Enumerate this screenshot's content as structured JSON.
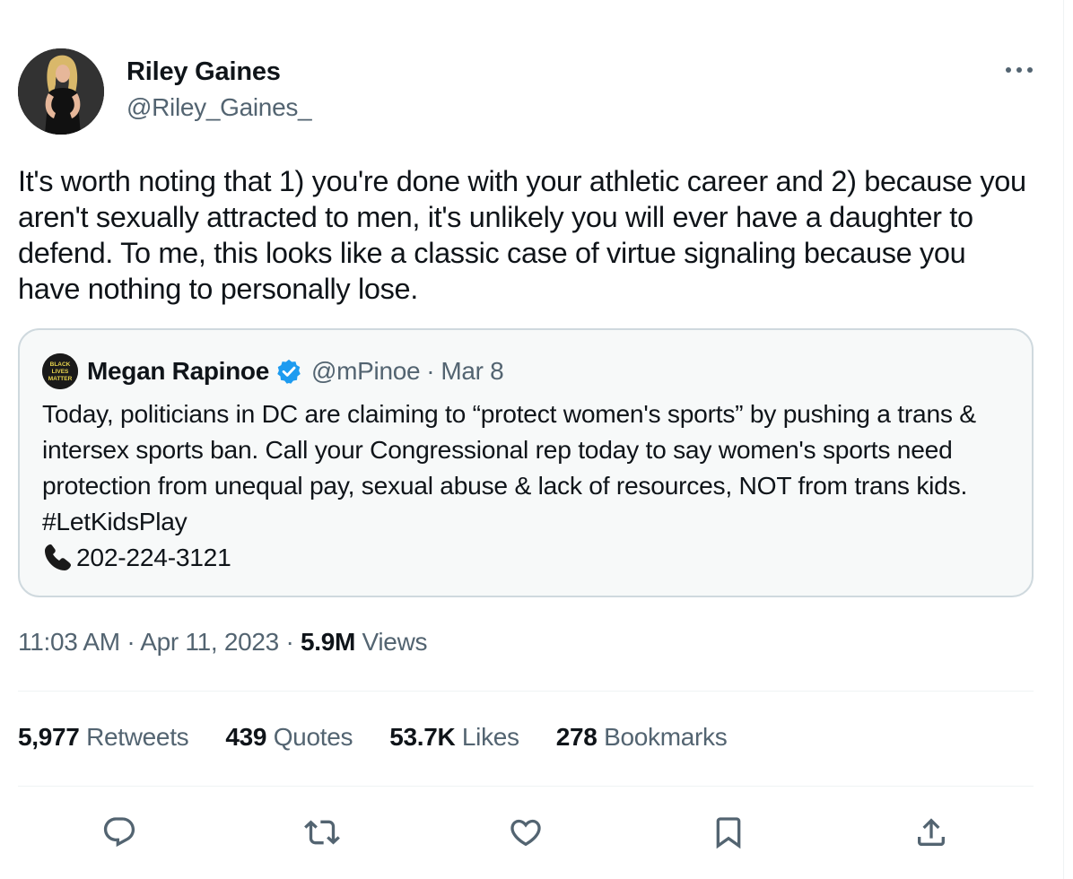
{
  "author": {
    "display_name": "Riley Gaines",
    "handle": "@Riley_Gaines_"
  },
  "tweet": {
    "text": "It's worth noting that 1) you're done with your athletic career and 2) because you aren't sexually attracted to men, it's unlikely you will ever have a daughter to defend. To me, this looks like a classic case of virtue signaling because you have nothing to personally lose."
  },
  "quoted_tweet": {
    "display_name": "Megan Rapinoe",
    "handle": "@mPinoe",
    "separator": "·",
    "date": "Mar 8",
    "avatar_text": "BLACK LIVES MATTER",
    "text": "Today, politicians in DC are claiming to “protect women's sports” by pushing a trans & intersex sports ban. Call your Congressional rep today to say women's sports need protection from unequal pay, sexual abuse & lack of resources, NOT from trans kids. #LetKidsPlay",
    "phone": "202-224-3121"
  },
  "meta": {
    "time": "11:03 AM",
    "separator": "·",
    "date": "Apr 11, 2023",
    "views_count": "5.9M",
    "views_label": "Views"
  },
  "stats": {
    "retweets": {
      "count": "5,977",
      "label": "Retweets"
    },
    "quotes": {
      "count": "439",
      "label": "Quotes"
    },
    "likes": {
      "count": "53.7K",
      "label": "Likes"
    },
    "bookmarks": {
      "count": "278",
      "label": "Bookmarks"
    }
  },
  "icons": {
    "more": "more-horizontal-icon",
    "verified": "verified-badge-icon",
    "phone": "phone-receiver-icon",
    "reply": "reply-icon",
    "retweet": "retweet-icon",
    "like": "heart-icon",
    "bookmark": "bookmark-icon",
    "share": "share-icon"
  },
  "colors": {
    "text_primary": "#0f1419",
    "text_secondary": "#536471",
    "border": "#cfd9de",
    "quote_background": "#f7f9f9",
    "verified_blue": "#1d9bf0",
    "divider": "#eff3f4"
  }
}
